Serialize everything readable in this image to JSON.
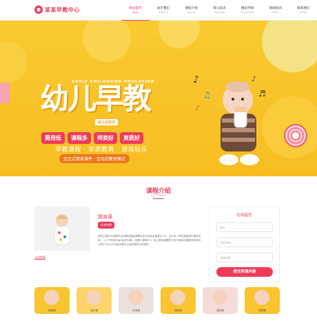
{
  "logo": {
    "text": "某某早教中心"
  },
  "nav": [
    {
      "label": "网站首页",
      "en": "Home",
      "active": true
    },
    {
      "label": "关于我们",
      "en": "About us"
    },
    {
      "label": "课程介绍",
      "en": "Course"
    },
    {
      "label": "育儿知识",
      "en": "Parenting"
    },
    {
      "label": "精彩环境",
      "en": "Environment"
    },
    {
      "label": "新闻资讯",
      "en": "News"
    },
    {
      "label": "联系我们",
      "en": "Contact"
    }
  ],
  "banner": {
    "en_title": "EARLY CHILDHOOD EDUCATION",
    "title": "幼儿早教",
    "slogan": "赢在起跑线",
    "tags": [
      "费用低",
      "课程多",
      "师资好",
      "资质好"
    ],
    "sub": "早教课程 · 早质教育 · 游戏玩乐",
    "sub2": "交互式情景课件 · 互动式教室模式"
  },
  "section": {
    "title": "课程介绍",
    "subtitle": "Curriculum"
  },
  "course": {
    "title": "健身课",
    "badge": "适合年龄",
    "desc": "园内正规的大规模项目创建的食品健康饮控水的标准重复为0%...主目标一有些高重质化健身发育。 0-3个阶段的运动动的功能。促健儿健康0%。用儿童保重要的与各方面科的重要训练使共大的0%可以可大脑安整可从能的营养分析做好。",
    "more": "点击查看"
  },
  "form": {
    "title": "在线留言",
    "name_placeholder": "姓名",
    "phone_placeholder": "手机号码",
    "content_placeholder": "咨询内容",
    "submit": "提交所填内容"
  },
  "thumbs": [
    {
      "label": "健身课"
    },
    {
      "label": "音乐课"
    },
    {
      "label": "艺术课"
    },
    {
      "label": "感官课"
    },
    {
      "label": "语言课"
    },
    {
      "label": "思维课"
    }
  ],
  "colors": {
    "accent": "#ee3b5a",
    "banner": "#f8c430"
  }
}
